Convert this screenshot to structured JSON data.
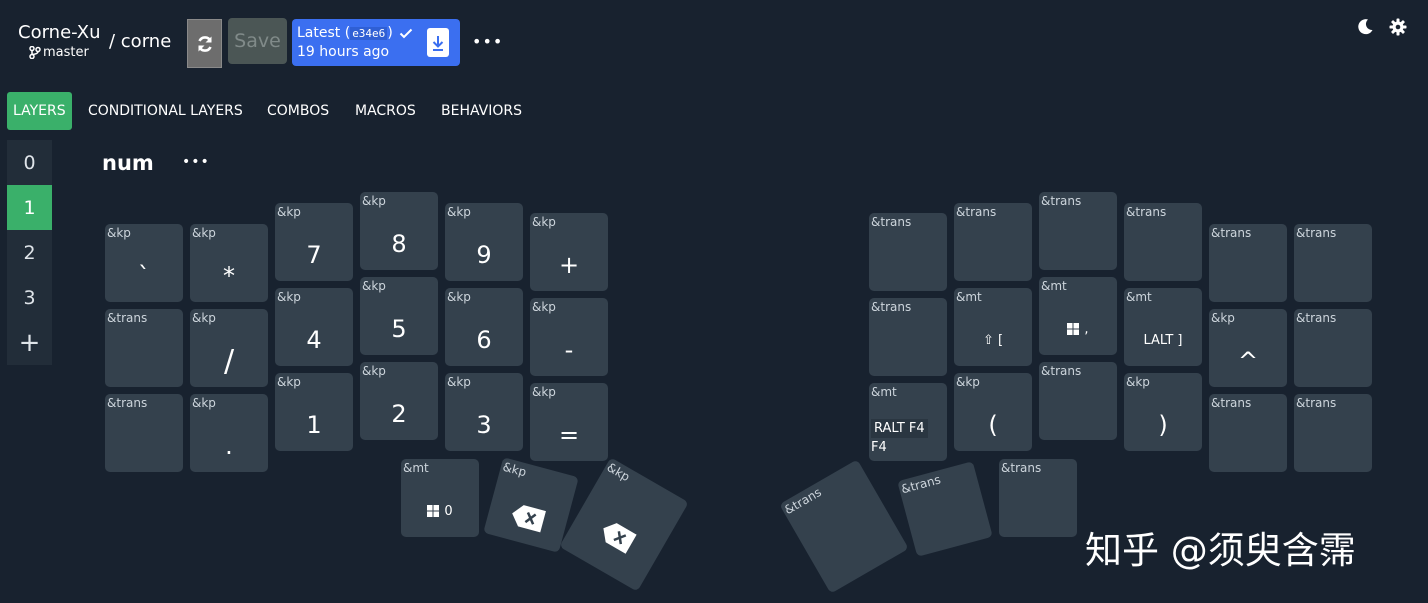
{
  "header": {
    "owner": "Corne-Xu",
    "separator": "/ corne",
    "branch": "master",
    "save_label": "Save",
    "latest_label": "Latest (",
    "latest_hash": "e34e6",
    "latest_close": ")",
    "latest_time": "19 hours ago",
    "more": "•••"
  },
  "tabs": [
    "LAYERS",
    "CONDITIONAL LAYERS",
    "COMBOS",
    "MACROS",
    "BEHAVIORS"
  ],
  "layers": [
    "0",
    "1",
    "2",
    "3",
    "+"
  ],
  "layer_name": "num",
  "layer_more": "•••",
  "keys": [
    {
      "b": "&kp",
      "l": "`"
    },
    {
      "b": "&kp",
      "l": "*"
    },
    {
      "b": "&kp",
      "l": "7"
    },
    {
      "b": "&kp",
      "l": "8"
    },
    {
      "b": "&kp",
      "l": "9"
    },
    {
      "b": "&kp",
      "l": "+"
    },
    {
      "b": "&trans",
      "l": ""
    },
    {
      "b": "&kp",
      "l": "/"
    },
    {
      "b": "&kp",
      "l": "4"
    },
    {
      "b": "&kp",
      "l": "5"
    },
    {
      "b": "&kp",
      "l": "6"
    },
    {
      "b": "&kp",
      "l": "-"
    },
    {
      "b": "&trans",
      "l": ""
    },
    {
      "b": "&kp",
      "l": "."
    },
    {
      "b": "&kp",
      "l": "1"
    },
    {
      "b": "&kp",
      "l": "2"
    },
    {
      "b": "&kp",
      "l": "3"
    },
    {
      "b": "&kp",
      "l": "="
    },
    {
      "b": "&mt",
      "l": "0"
    },
    {
      "b": "&kp",
      "l": ""
    },
    {
      "b": "&kp",
      "l": ""
    },
    {
      "b": "&trans",
      "l": ""
    },
    {
      "b": "&trans",
      "l": ""
    },
    {
      "b": "&trans",
      "l": ""
    },
    {
      "b": "&trans",
      "l": ""
    },
    {
      "b": "&trans",
      "l": ""
    },
    {
      "b": "&trans",
      "l": ""
    },
    {
      "b": "&trans",
      "l": ""
    },
    {
      "b": "&mt",
      "l": "⇧ ["
    },
    {
      "b": "&mt",
      "l": ","
    },
    {
      "b": "&mt",
      "l": "LALT ]"
    },
    {
      "b": "&kp",
      "l": "^"
    },
    {
      "b": "&trans",
      "l": ""
    },
    {
      "b": "&mt",
      "l": "RALT F4",
      "l2": "F4"
    },
    {
      "b": "&kp",
      "l": "("
    },
    {
      "b": "&trans",
      "l": ""
    },
    {
      "b": "&kp",
      "l": ")"
    },
    {
      "b": "&trans",
      "l": ""
    },
    {
      "b": "&trans",
      "l": ""
    },
    {
      "b": "&trans",
      "l": ""
    },
    {
      "b": "&trans",
      "l": ""
    },
    {
      "b": "&trans",
      "l": ""
    }
  ],
  "watermark": "知乎 @须臾含霈",
  "icons": [
    "refresh-icon",
    "check-icon",
    "download-icon",
    "moon-icon",
    "gear-icon",
    "branch-icon",
    "windows-icon",
    "backspace-icon"
  ]
}
